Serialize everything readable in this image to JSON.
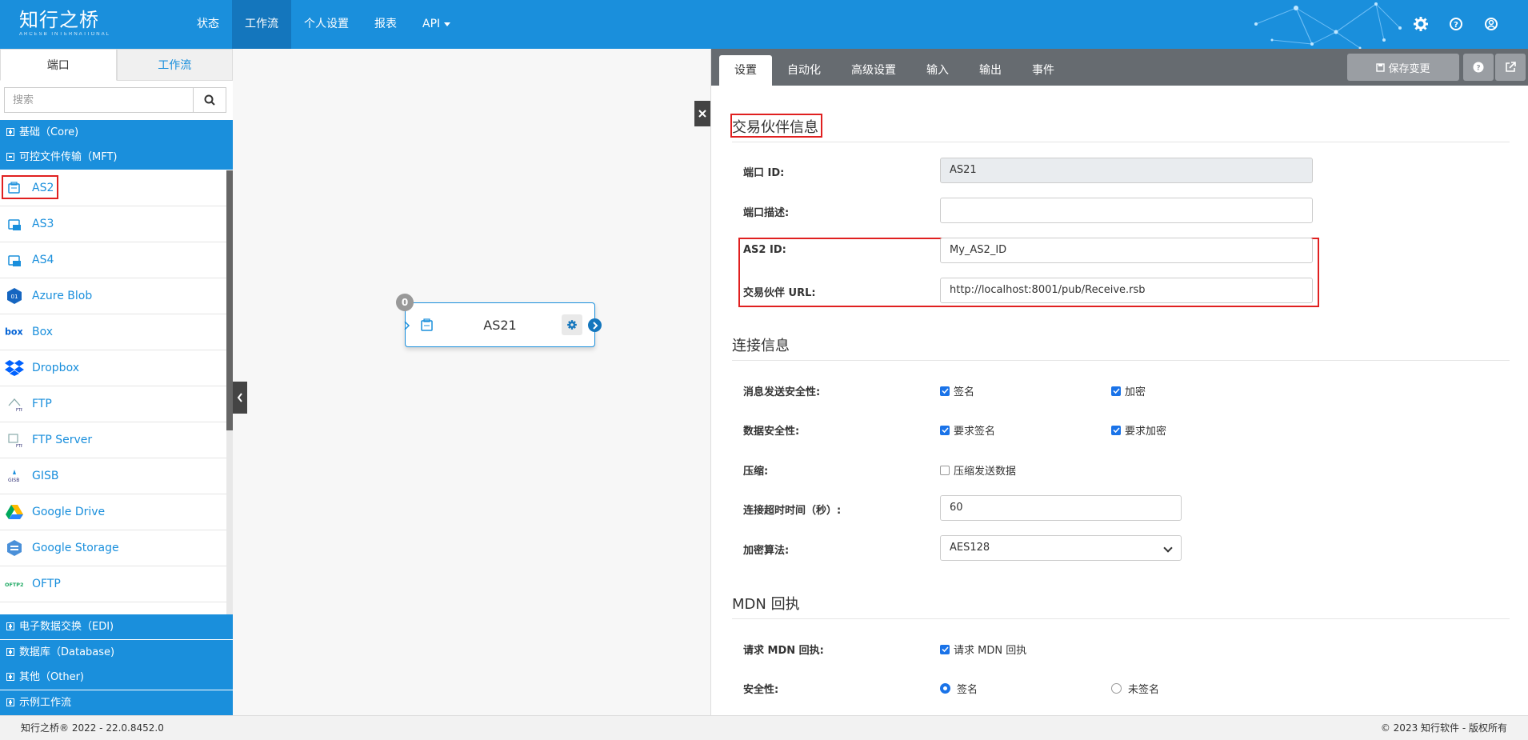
{
  "brand": {
    "name": "知行之桥",
    "subtitle": "ARCESB INTERNATIONAL"
  },
  "nav": {
    "items": [
      "状态",
      "工作流",
      "个人设置",
      "报表",
      "API"
    ],
    "active": "工作流"
  },
  "left": {
    "tabs": [
      "端口",
      "工作流"
    ],
    "search_placeholder": "搜索",
    "categories_top": [
      "基础（Core)",
      "可控文件传输（MFT)"
    ],
    "ports": [
      {
        "label": "AS2",
        "icon": "as2-icon"
      },
      {
        "label": "AS3",
        "icon": "as3-icon"
      },
      {
        "label": "AS4",
        "icon": "as4-icon"
      },
      {
        "label": "Azure Blob",
        "icon": "azure-blob-icon"
      },
      {
        "label": "Box",
        "icon": "box-icon"
      },
      {
        "label": "Dropbox",
        "icon": "dropbox-icon"
      },
      {
        "label": "FTP",
        "icon": "ftp-icon"
      },
      {
        "label": "FTP Server",
        "icon": "ftp-server-icon"
      },
      {
        "label": "GISB",
        "icon": "gisb-icon"
      },
      {
        "label": "Google Drive",
        "icon": "google-drive-icon"
      },
      {
        "label": "Google Storage",
        "icon": "google-storage-icon"
      },
      {
        "label": "OFTP",
        "icon": "oftp-icon"
      }
    ],
    "categories_bottom": [
      "电子数据交换（EDI)",
      "数据库（Database)",
      "其他（Other)",
      "示例工作流"
    ]
  },
  "canvas": {
    "node": {
      "label": "AS21",
      "badge": "0"
    }
  },
  "right": {
    "tabs": [
      "设置",
      "自动化",
      "高级设置",
      "输入",
      "输出",
      "事件"
    ],
    "save_label": "保存变更",
    "partner_section": "交易伙伴信息",
    "fields": {
      "port_id_label": "端口 ID:",
      "port_id_value": "AS21",
      "port_desc_label": "端口描述:",
      "port_desc_value": "",
      "as2_id_label": "AS2 ID:",
      "as2_id_value": "My_AS2_ID",
      "partner_url_label": "交易伙伴 URL:",
      "partner_url_value": "http://localhost:8001/pub/Receive.rsb"
    },
    "conn_section": "连接信息",
    "conn": {
      "msg_security_label": "消息发送安全性:",
      "msg_sign": "签名",
      "msg_encrypt": "加密",
      "data_security_label": "数据安全性:",
      "req_sign": "要求签名",
      "req_encrypt": "要求加密",
      "compress_label": "压缩:",
      "compress_option": "压缩发送数据",
      "timeout_label": "连接超时时间（秒）:",
      "timeout_value": "60",
      "algo_label": "加密算法:",
      "algo_value": "AES128"
    },
    "mdn_section": "MDN 回执",
    "mdn": {
      "request_label": "请求 MDN 回执:",
      "request_option": "请求 MDN 回执",
      "security_label": "安全性:",
      "signed": "签名",
      "unsigned": "未签名"
    }
  },
  "footer": {
    "left": "知行之桥® 2022 - 22.0.8452.0",
    "right": "© 2023 知行软件 - 版权所有"
  },
  "colors": {
    "primary": "#1a8fdc",
    "highlight": "#e02020",
    "tabbar": "#666b70"
  }
}
